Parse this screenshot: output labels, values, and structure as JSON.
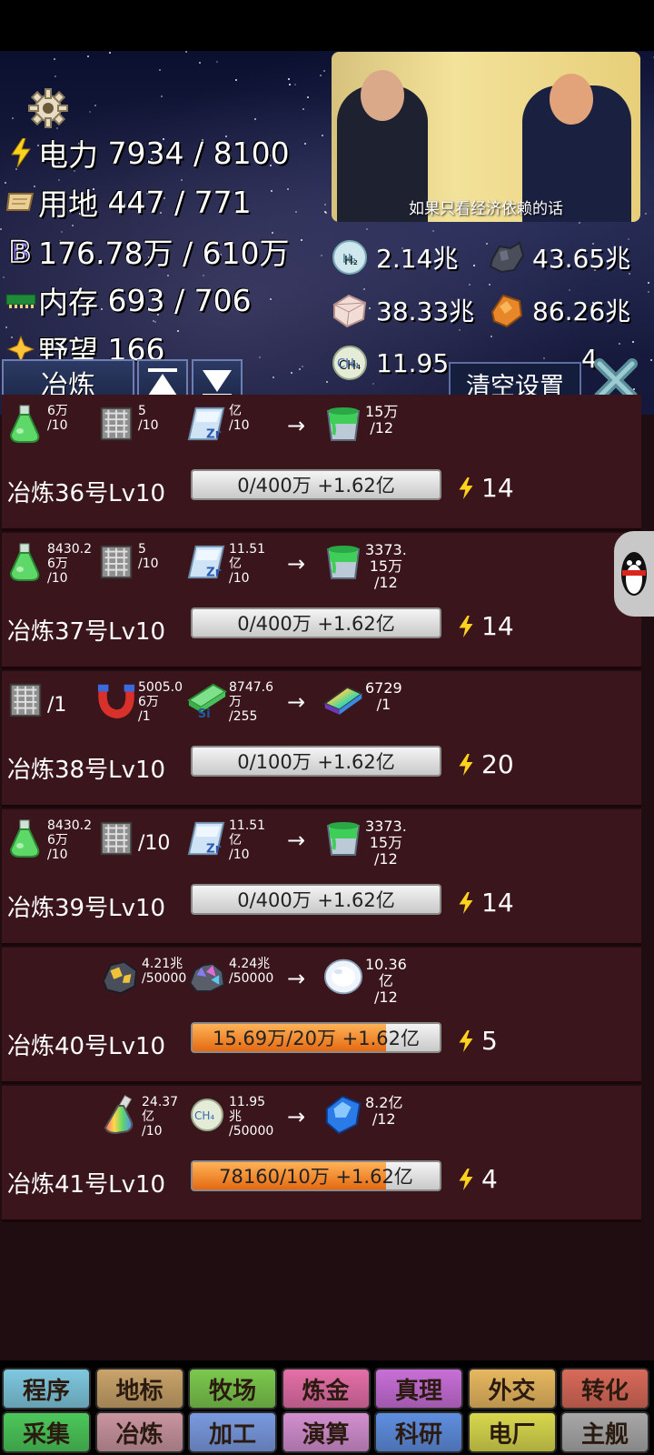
{
  "header": {
    "resources": [
      {
        "icon": "lightning-icon",
        "label": "电力",
        "value": "7934 / 8100"
      },
      {
        "icon": "scroll-icon",
        "label": "用地",
        "value": "447 / 771"
      },
      {
        "icon": "b-coin-icon",
        "label": "",
        "value": "176.78万 / 610万"
      },
      {
        "icon": "memory-icon",
        "label": "内存",
        "value": "693 / 706"
      },
      {
        "icon": "star-icon",
        "label": "野望",
        "value": "166"
      }
    ],
    "materials": [
      {
        "icon": "hydrogen-icon",
        "value": "2.14兆"
      },
      {
        "icon": "ore-icon",
        "value": "43.65兆"
      },
      {
        "icon": "crystal-cube-icon",
        "value": "38.33兆"
      },
      {
        "icon": "amber-gem-icon",
        "value": "86.26兆"
      },
      {
        "icon": "methane-icon",
        "value": "11.95"
      },
      {
        "icon": "partial-icon",
        "value": "4"
      }
    ],
    "video_caption": "如果只看经济依赖的话",
    "tab_label": "冶炼",
    "clear_label": "清空设置"
  },
  "cards": [
    {
      "name": "冶炼36号Lv10",
      "progress_text": "0/400万 +1.62亿",
      "progress": 0,
      "power": "14",
      "inputs": [
        {
          "icon": "green-flask-icon",
          "qty": [
            "6万",
            "/10"
          ]
        },
        {
          "icon": "chip-icon",
          "qty": [
            "5",
            "/10"
          ]
        },
        {
          "icon": "zr-plate-icon",
          "qty": [
            "亿",
            "/10"
          ]
        }
      ],
      "output": {
        "icon": "green-bucket-icon",
        "qty": [
          "15万",
          "/12"
        ]
      }
    },
    {
      "name": "冶炼37号Lv10",
      "progress_text": "0/400万 +1.62亿",
      "progress": 0,
      "power": "14",
      "inputs": [
        {
          "icon": "green-flask-icon",
          "qty": [
            "8430.2",
            "6万",
            "/10"
          ]
        },
        {
          "icon": "chip-icon",
          "qty": [
            "5",
            "/10"
          ]
        },
        {
          "icon": "zr-plate-icon",
          "qty": [
            "11.51",
            "亿",
            "/10"
          ]
        }
      ],
      "output": {
        "icon": "green-bucket-icon",
        "qty": [
          "3373.",
          "15万",
          "/12"
        ]
      }
    },
    {
      "name": "冶炼38号Lv10",
      "progress_text": "0/100万 +1.62亿",
      "progress": 0,
      "power": "20",
      "inputs": [
        {
          "icon": "chip-icon",
          "qty": [
            "/1"
          ]
        },
        {
          "icon": "magnet-icon",
          "qty": [
            "5005.0",
            "6万",
            "/1"
          ]
        },
        {
          "icon": "si-ingot-icon",
          "qty": [
            "8747.6",
            "万",
            "/255"
          ]
        }
      ],
      "output": {
        "icon": "rainbow-ingot-icon",
        "qty": [
          "6729",
          "/1"
        ]
      }
    },
    {
      "name": "冶炼39号Lv10",
      "progress_text": "0/400万 +1.62亿",
      "progress": 0,
      "power": "14",
      "inputs": [
        {
          "icon": "green-flask-icon",
          "qty": [
            "8430.2",
            "6万",
            "/10"
          ]
        },
        {
          "icon": "chip-icon",
          "qty": [
            "/10"
          ]
        },
        {
          "icon": "zr-plate-icon",
          "qty": [
            "11.51",
            "亿",
            "/10"
          ]
        }
      ],
      "output": {
        "icon": "green-bucket-icon",
        "qty": [
          "3373.",
          "15万",
          "/12"
        ]
      }
    },
    {
      "name": "冶炼40号Lv10",
      "progress_text": "15.69万/20万 +1.62亿",
      "progress": 0.7845,
      "power": "5",
      "inputs": [
        {
          "icon": "gold-ore-icon",
          "qty": [
            "4.21兆",
            "/50000"
          ]
        },
        {
          "icon": "crystal-ore-icon",
          "qty": [
            "4.24兆",
            "/50000"
          ]
        }
      ],
      "output": {
        "icon": "white-orb-icon",
        "qty": [
          "10.36",
          "亿",
          "/12"
        ]
      }
    },
    {
      "name": "冶炼41号Lv10",
      "progress_text": "78160/10万 +1.62亿",
      "progress": 0.7816,
      "power": "4",
      "inputs": [
        {
          "icon": "rainbow-flask-icon",
          "qty": [
            "24.37",
            "亿",
            "/10"
          ]
        },
        {
          "icon": "methane-icon",
          "qty": [
            "11.95",
            "兆",
            "/50000"
          ]
        }
      ],
      "output": {
        "icon": "blue-crystal-icon",
        "qty": [
          "8.2亿",
          "/12"
        ]
      }
    }
  ],
  "nav_row1": [
    {
      "label": "程序",
      "color": "#7fc8e0"
    },
    {
      "label": "地标",
      "color": "#c9a36a"
    },
    {
      "label": "牧场",
      "color": "#7cc84e"
    },
    {
      "label": "炼金",
      "color": "#e46fa8"
    },
    {
      "label": "真理",
      "color": "#c86fd8"
    },
    {
      "label": "外交",
      "color": "#e8b860"
    },
    {
      "label": "转化",
      "color": "#d96a5a"
    }
  ],
  "nav_row2": [
    {
      "label": "采集",
      "color": "#4cc85a"
    },
    {
      "label": "冶炼",
      "color": "#c995a0"
    },
    {
      "label": "加工",
      "color": "#7a9ae0"
    },
    {
      "label": "演算",
      "color": "#d38fd0"
    },
    {
      "label": "科研",
      "color": "#5f8ee0"
    },
    {
      "label": "电厂",
      "color": "#d8d84e"
    },
    {
      "label": "主舰",
      "color": "#a8a8a8"
    }
  ]
}
